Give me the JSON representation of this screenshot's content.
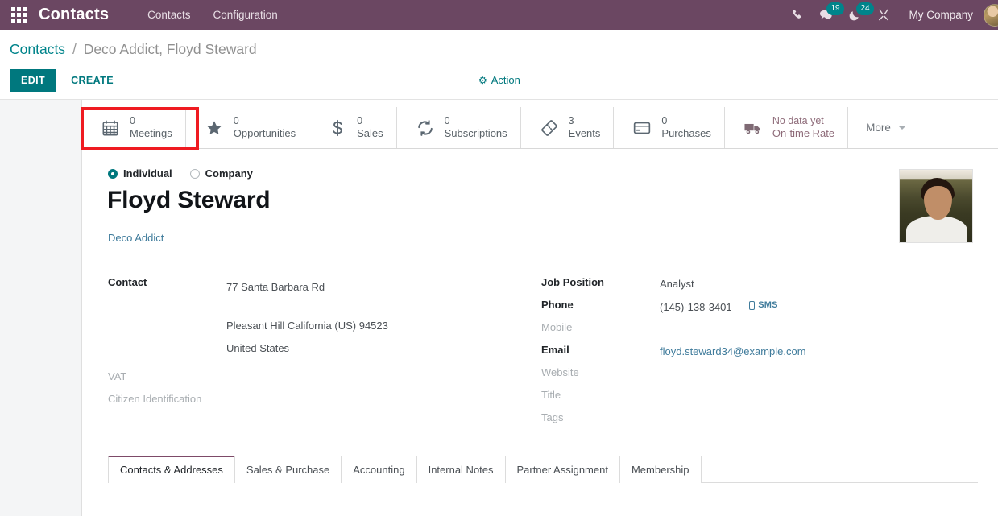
{
  "navbar": {
    "apps_icon": "apps-grid-icon",
    "brand": "Contacts",
    "menu": [
      {
        "label": "Contacts"
      },
      {
        "label": "Configuration"
      }
    ],
    "icons": [
      {
        "name": "phone-icon",
        "glyph": "✆",
        "badge": null
      },
      {
        "name": "messages-icon",
        "glyph": "ὊC",
        "badge": "19"
      },
      {
        "name": "activities-icon",
        "glyph": "☾",
        "badge": "24"
      },
      {
        "name": "tools-icon",
        "glyph": "⚒",
        "badge": null
      }
    ],
    "company": "My Company",
    "accent": "#6b4762"
  },
  "control_panel": {
    "breadcrumb_root": "Contacts",
    "breadcrumb_separator": "/",
    "breadcrumb_current": "Deco Addict, Floyd Steward",
    "edit_label": "EDIT",
    "create_label": "CREATE",
    "action_label": "Action",
    "action_icon": "gear-icon",
    "accent": "#00787e"
  },
  "stat_buttons": [
    {
      "value": "0",
      "label": "Meetings",
      "icon": "calendar-icon",
      "highlighted": true
    },
    {
      "value": "0",
      "label": "Opportunities",
      "icon": "star-icon",
      "highlighted": false
    },
    {
      "value": "0",
      "label": "Sales",
      "icon": "dollar-icon",
      "highlighted": false
    },
    {
      "value": "0",
      "label": "Subscriptions",
      "icon": "refresh-icon",
      "highlighted": false
    },
    {
      "value": "3",
      "label": "Events",
      "icon": "ticket-icon",
      "highlighted": false
    },
    {
      "value": "0",
      "label": "Purchases",
      "icon": "credit-card-icon",
      "highlighted": false
    },
    {
      "value": "No data yet",
      "label": "On-time Rate",
      "icon": "truck-icon",
      "highlighted": false,
      "no_data": true
    }
  ],
  "stat_more_label": "More",
  "annotation": {
    "color": "#ef1b21",
    "target": "Meetings"
  },
  "form": {
    "type_options": [
      {
        "label": "Individual",
        "selected": true
      },
      {
        "label": "Company",
        "selected": false
      }
    ],
    "name": "Floyd Steward",
    "parent_company": "Deco Addict",
    "photo_alt": "contact-photo",
    "left_fields": [
      {
        "label": "Contact",
        "filled": true
      },
      {
        "label": "VAT",
        "filled": false
      },
      {
        "label": "Citizen Identification",
        "filled": false
      }
    ],
    "address": {
      "street": "77 Santa Barbara Rd",
      "city_state_zip": "Pleasant Hill  California (US)  94523",
      "country": "United States"
    },
    "right_fields": [
      {
        "label": "Job Position",
        "value": "Analyst",
        "filled": true,
        "link": false
      },
      {
        "label": "Phone",
        "value": "(145)-138-3401",
        "filled": true,
        "link": true,
        "sms": "SMS"
      },
      {
        "label": "Mobile",
        "value": "",
        "filled": false,
        "link": false
      },
      {
        "label": "Email",
        "value": "floyd.steward34@example.com",
        "filled": true,
        "link": true
      },
      {
        "label": "Website",
        "value": "",
        "filled": false,
        "link": false
      },
      {
        "label": "Title",
        "value": "",
        "filled": false,
        "link": false
      },
      {
        "label": "Tags",
        "value": "",
        "filled": false,
        "link": false
      }
    ]
  },
  "notebook_tabs": [
    {
      "label": "Contacts & Addresses",
      "active": true
    },
    {
      "label": "Sales & Purchase",
      "active": false
    },
    {
      "label": "Accounting",
      "active": false
    },
    {
      "label": "Internal Notes",
      "active": false
    },
    {
      "label": "Partner Assignment",
      "active": false
    },
    {
      "label": "Membership",
      "active": false
    }
  ]
}
